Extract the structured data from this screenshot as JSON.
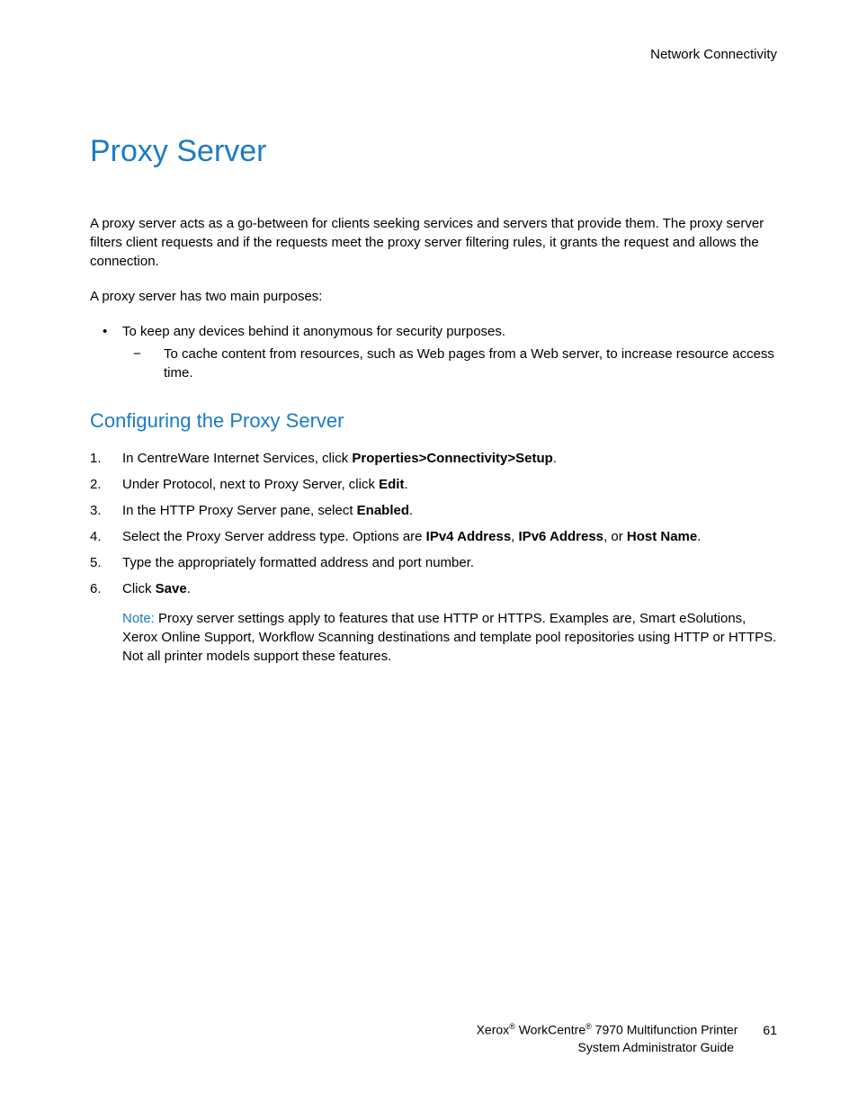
{
  "header": {
    "section": "Network Connectivity"
  },
  "title": "Proxy Server",
  "intro": "A proxy server acts as a go-between for clients seeking services and servers that provide them. The proxy server filters client requests and if the requests meet the proxy server filtering rules, it grants the request and allows the connection.",
  "purposesLead": "A proxy server has two main purposes:",
  "bullet1": "To keep any devices behind it anonymous for security purposes.",
  "subBullet1": "To cache content from resources, such as Web pages from a Web server, to increase resource access time.",
  "subtitle": "Configuring the Proxy Server",
  "steps": {
    "s1": {
      "n": "1.",
      "pre": "In CentreWare Internet Services, click ",
      "bold": "Properties>Connectivity>Setup",
      "post": "."
    },
    "s2": {
      "n": "2.",
      "pre": "Under Protocol, next to Proxy Server, click ",
      "bold": "Edit",
      "post": "."
    },
    "s3": {
      "n": "3.",
      "pre": "In the HTTP Proxy Server pane, select ",
      "bold": "Enabled",
      "post": "."
    },
    "s4": {
      "n": "4.",
      "pre": "Select the Proxy Server address type. Options are ",
      "b1": "IPv4 Address",
      "sep1": ", ",
      "b2": "IPv6 Address",
      "sep2": ", or ",
      "b3": "Host Name",
      "post": "."
    },
    "s5": {
      "n": "5.",
      "text": "Type the appropriately formatted address and port number."
    },
    "s6": {
      "n": "6.",
      "pre": "Click ",
      "bold": "Save",
      "post": "."
    }
  },
  "note": {
    "label": "Note:",
    "text": " Proxy server settings apply to features that use HTTP or HTTPS. Examples are, Smart eSolutions, Xerox Online Support, Workflow Scanning destinations and template pool repositories using HTTP or HTTPS. Not all printer models support these features."
  },
  "footer": {
    "line1a": "Xerox",
    "line1b": " WorkCentre",
    "line1c": " 7970 Multifunction Printer",
    "line2": "System Administrator Guide",
    "page": "61"
  }
}
